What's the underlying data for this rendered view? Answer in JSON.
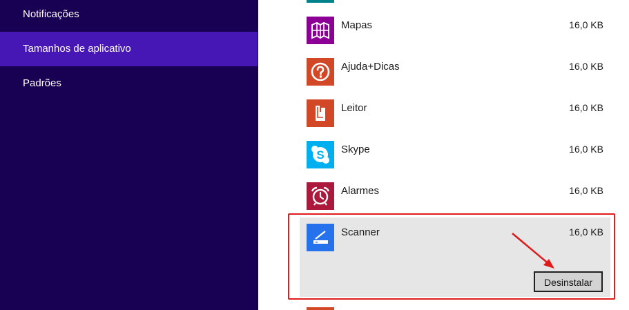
{
  "sidebar": {
    "items": [
      {
        "label": "Notificações"
      },
      {
        "label": "Tamanhos de aplicativo",
        "selected": true
      },
      {
        "label": "Padrões"
      }
    ]
  },
  "apps": [
    {
      "name": "Mapas",
      "size": "16,0 KB",
      "color": "#8c0095",
      "icon": "map-icon"
    },
    {
      "name": "Ajuda+Dicas",
      "size": "16,0 KB",
      "color": "#d24726",
      "icon": "help-icon"
    },
    {
      "name": "Leitor",
      "size": "16,0 KB",
      "color": "#d24726",
      "icon": "reader-icon"
    },
    {
      "name": "Skype",
      "size": "16,0 KB",
      "color": "#00aff0",
      "icon": "skype-icon"
    },
    {
      "name": "Alarmes",
      "size": "16,0 KB",
      "color": "#ac193d",
      "icon": "alarm-clock-icon"
    },
    {
      "name": "Scanner",
      "size": "16,0 KB",
      "color": "#2672ec",
      "icon": "scanner-icon",
      "selected": true
    }
  ],
  "uninstall_button": {
    "label": "Desinstalar"
  },
  "colors": {
    "sidebar_bg": "#180052",
    "sidebar_selected": "#4617b4",
    "highlight": "#e01b1b",
    "selected_row_bg": "#e6e6e6"
  }
}
